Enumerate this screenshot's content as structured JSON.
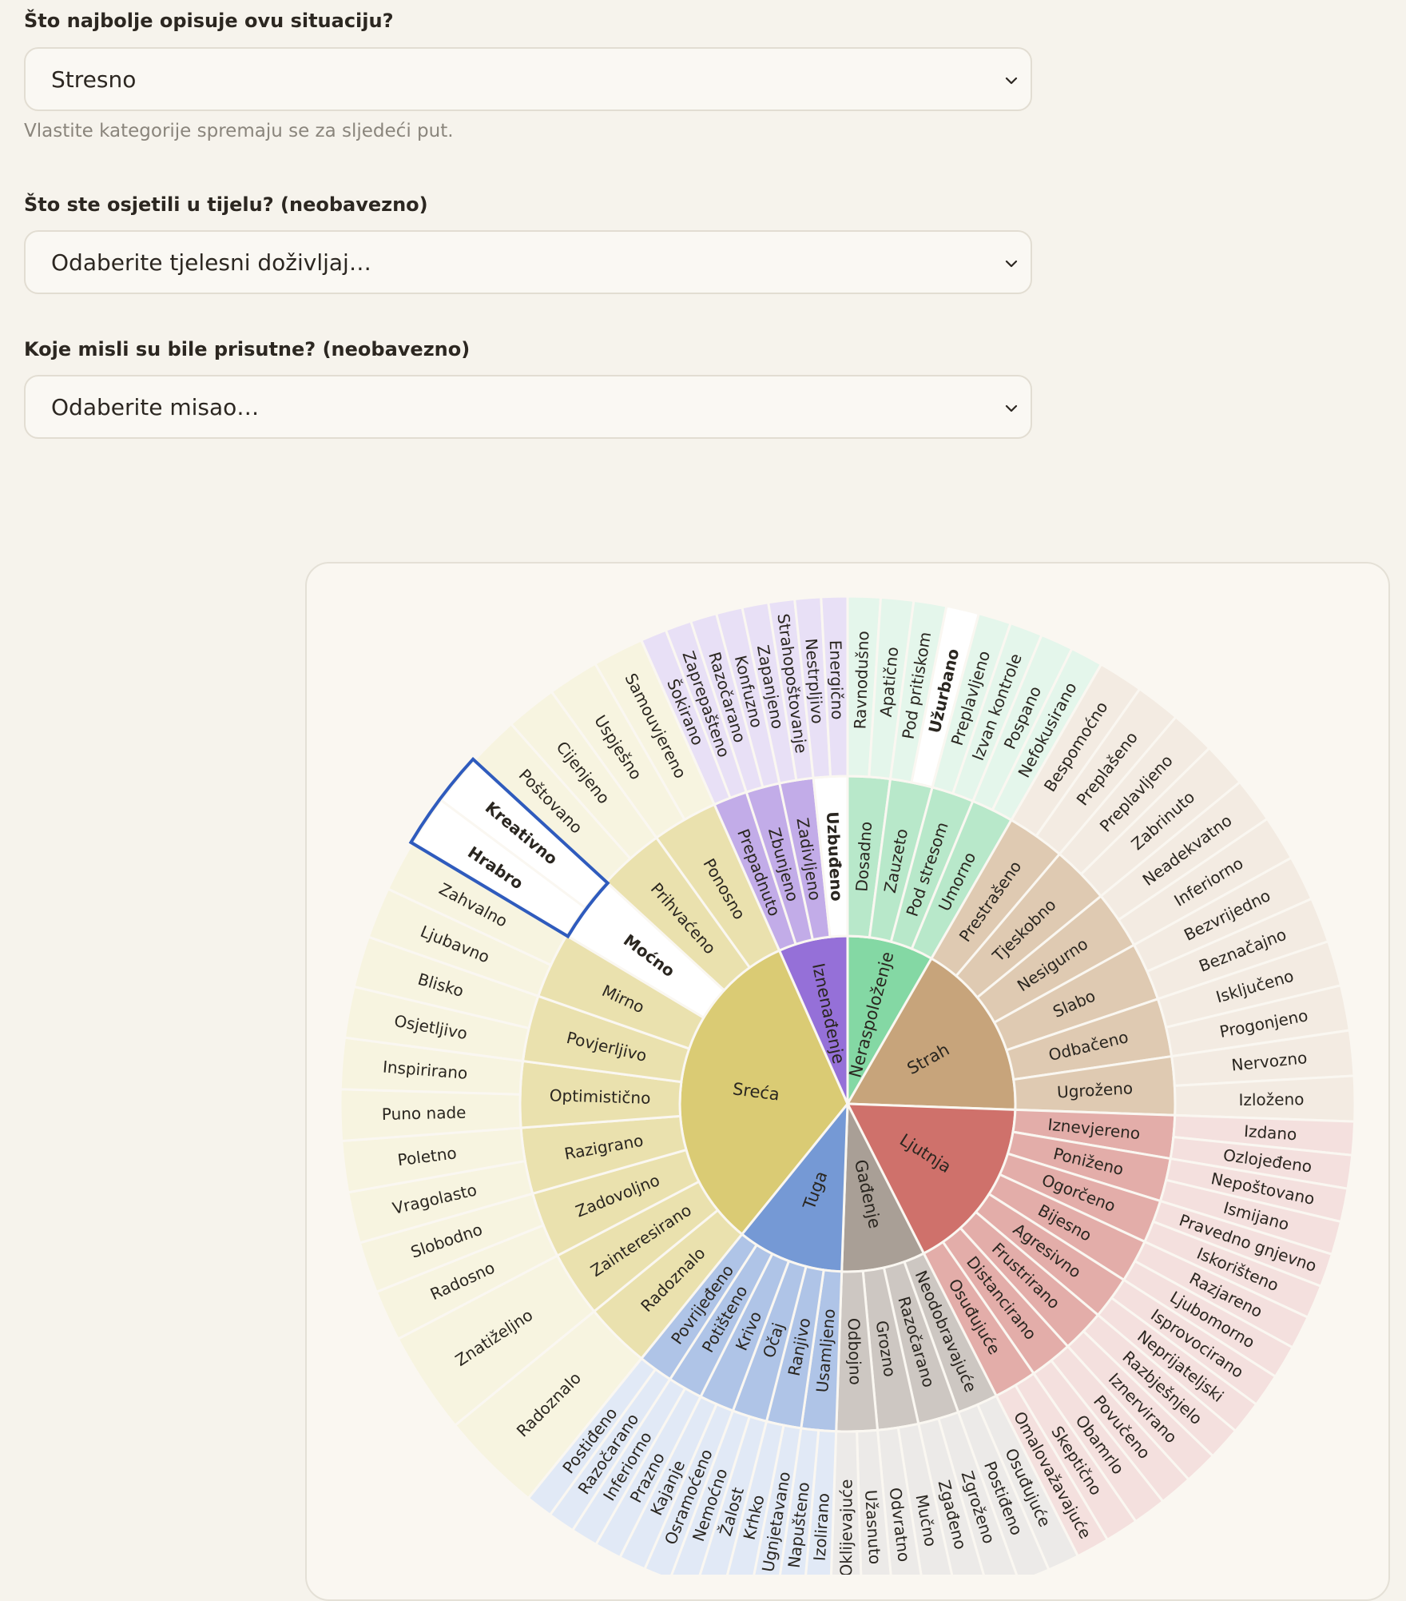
{
  "form": {
    "situation": {
      "label": "Što najbolje opisuje ovu situaciju?",
      "value": "Stresno",
      "hint": "Vlastite kategorije spremaju se za sljedeći put."
    },
    "body": {
      "label": "Što ste osjetili u tijelu? (neobavezno)",
      "value": "Odaberite tjelesni doživljaj…"
    },
    "thoughts": {
      "label": "Koje misli su bile prisutne? (neobavezno)",
      "value": "Odaberite misao…"
    }
  },
  "wheel": {
    "colors": {
      "Sreća": "#dacb74",
      "Iznenađenje": "#9570d8",
      "Neraspoloženje": "#84d8a4",
      "Strah": "#c7a47b",
      "Ljutnja": "#cf716b",
      "Gađenje": "#a99f96",
      "Tuga": "#7599d5"
    },
    "focus_outline_color": "#2f5bbd",
    "core": [
      {
        "name": "Sreća",
        "outer": [
          {
            "name": "Radoznalo",
            "items": [
              "Radoznalo"
            ]
          },
          {
            "name": "Zainteresirano",
            "items": [
              "Znatiželjno"
            ]
          },
          {
            "name": "Zadovoljno",
            "items": [
              "Radosno",
              "Slobodno"
            ]
          },
          {
            "name": "Razigrano",
            "items": [
              "Vragolasto",
              "Poletno"
            ]
          }
        ],
        "outer_rev": [
          {
            "name": "Ponosno",
            "items": [
              "Uspješno",
              "Samouvjereno"
            ]
          },
          {
            "name": "Prihvaćeno",
            "items": [
              "Poštovano",
              "Cijenjeno"
            ]
          },
          {
            "name": "Moćno",
            "items": [
              "Hrabro",
              "Kreativno"
            ]
          },
          {
            "name": "Mirno",
            "items": [
              "Ljubavno",
              "Zahvalno"
            ]
          },
          {
            "name": "Povjerljivo",
            "items": [
              "Osjetljivo",
              "Blisko"
            ]
          },
          {
            "name": "Optimistično",
            "items": [
              "Puno nade",
              "Inspirirano"
            ]
          }
        ]
      },
      {
        "name": "Iznenađenje",
        "outer": [
          {
            "name": "Prepadnuto",
            "items": [
              "Šokirano",
              "Zaprepašteno"
            ]
          },
          {
            "name": "Zbunjeno",
            "items": [
              "Razočarano",
              "Konfuzno"
            ]
          },
          {
            "name": "Zadivljeno",
            "items": [
              "Zapanjeno",
              "Strahopoštovanje"
            ]
          },
          {
            "name": "Uzbuđeno",
            "items": [
              "Nestrpljivo",
              "Energično"
            ]
          }
        ]
      },
      {
        "name": "Neraspoloženje",
        "outer": [
          {
            "name": "Dosadno",
            "items": [
              "Ravnodušno",
              "Apatično"
            ]
          },
          {
            "name": "Zauzeto",
            "items": [
              "Pod pritiskom",
              "Užurbano"
            ]
          },
          {
            "name": "Pod stresom",
            "items": [
              "Preplavljeno",
              "Izvan kontrole"
            ]
          },
          {
            "name": "Umorno",
            "items": [
              "Pospano",
              "Nefokusirano"
            ]
          }
        ]
      },
      {
        "name": "Strah",
        "outer": [
          {
            "name": "Prestrašeno",
            "items": [
              "Bespomoćno",
              "Preplašeno"
            ]
          },
          {
            "name": "Tjeskobno",
            "items": [
              "Preplavljeno",
              "Zabrinuto"
            ]
          },
          {
            "name": "Nesigurno",
            "items": [
              "Neadekvatno",
              "Inferiorno"
            ]
          },
          {
            "name": "Slabo",
            "items": [
              "Bezvrijedno",
              "Beznačajno"
            ]
          },
          {
            "name": "Odbačeno",
            "items": [
              "Isključeno",
              "Progonjeno"
            ]
          },
          {
            "name": "Ugroženo",
            "items": [
              "Nervozno",
              "Izloženo"
            ]
          }
        ]
      },
      {
        "name": "Ljutnja",
        "outer": [
          {
            "name": "Iznevjereno",
            "items": [
              "Izdano",
              "Ozlojeđeno"
            ]
          },
          {
            "name": "Poniženo",
            "items": [
              "Nepoštovano",
              "Ismijano"
            ]
          },
          {
            "name": "Ogorčeno",
            "items": [
              "Pravedno gnjevno",
              "Iskorišteno"
            ]
          },
          {
            "name": "Bijesno",
            "items": [
              "Razjareno",
              "Ljubomorno"
            ]
          },
          {
            "name": "Agresivno",
            "items": [
              "Isprovocirano",
              "Neprijateljski"
            ]
          },
          {
            "name": "Frustrirano",
            "items": [
              "Razbješnjelo",
              "Iznervirano"
            ]
          },
          {
            "name": "Distancirano",
            "items": [
              "Povučeno",
              "Obamrlo"
            ]
          },
          {
            "name": "Osuđujuće",
            "items": [
              "Skeptično",
              "Omalovažavajuće"
            ]
          }
        ]
      },
      {
        "name": "Gađenje",
        "outer": [
          {
            "name": "Neodobravajuće",
            "items": [
              "Osuđujuće",
              "Postiđeno"
            ]
          },
          {
            "name": "Razočarano",
            "items": [
              "Zgroženo",
              "Zgađeno"
            ]
          },
          {
            "name": "Grozno",
            "items": [
              "Mučno",
              "Odvratno"
            ]
          },
          {
            "name": "Odbojno",
            "items": [
              "Užasnuto",
              "Oklijevajuće"
            ]
          }
        ]
      },
      {
        "name": "Tuga",
        "outer": [
          {
            "name": "Usamljeno",
            "items": [
              "Izolirano",
              "Napušteno"
            ]
          },
          {
            "name": "Ranjivo",
            "items": [
              "Ugnjetavano",
              "Krhko"
            ]
          },
          {
            "name": "Očaj",
            "items": [
              "Žalost",
              "Nemoćno"
            ]
          },
          {
            "name": "Krivo",
            "items": [
              "Osramoćeno",
              "Kajanje"
            ]
          },
          {
            "name": "Potišteno",
            "items": [
              "Prazno",
              "Inferiorno"
            ]
          },
          {
            "name": "Povrijeđeno",
            "items": [
              "Razočarano",
              "Postiđeno"
            ]
          }
        ]
      }
    ],
    "selected": [
      "Uzbuđeno",
      "Užurbano",
      "Moćno",
      "Kreativno",
      "Hrabro"
    ],
    "focused": [
      "Kreativno",
      "Hrabro"
    ]
  }
}
